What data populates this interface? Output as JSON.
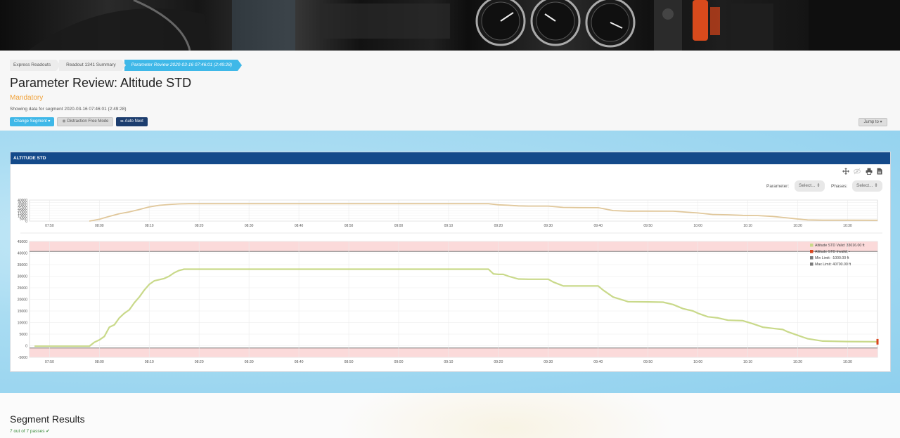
{
  "breadcrumb": {
    "items": [
      "Express Readouts",
      "Readout 1341 Summary",
      "Parameter Review 2020-03-16 07:46:01 (2:49:28)"
    ]
  },
  "page": {
    "title": "Parameter Review: Altitude STD",
    "subtitle": "Mandatory",
    "segment_info": "Showing data for segment 2020-03-16 07:46:01 (2:49:28)"
  },
  "toolbar": {
    "change_segment": "Change Segment",
    "distraction_free": "Distraction Free Mode",
    "auto_next": "Auto Next",
    "jump_to": "Jump to"
  },
  "panel": {
    "title": "ALTITUDE STD",
    "parameter_label": "Parameter:",
    "parameter_select": "Select...",
    "phases_label": "Phases:",
    "phases_select": "Select..."
  },
  "icons": {
    "move": "move-icon",
    "hide": "eye-slash-icon",
    "print": "print-icon",
    "export": "document-icon"
  },
  "chart_data": [
    {
      "type": "line",
      "title": "",
      "x_ticks": [
        "07:50",
        "08:00",
        "08:10",
        "08:20",
        "08:30",
        "08:40",
        "08:50",
        "09:00",
        "09:10",
        "09:20",
        "09:30",
        "09:40",
        "09:50",
        "10:00",
        "10:10",
        "10:20",
        "10:30"
      ],
      "y_ticks": [
        0,
        5000,
        10000,
        15000,
        20000,
        25000,
        30000,
        35000,
        40000
      ],
      "ylim": [
        0,
        40000
      ],
      "series": [
        {
          "color": "#e0c79a",
          "x": [
            "07:58",
            "08:00",
            "08:02",
            "08:04",
            "08:06",
            "08:08",
            "08:10",
            "08:12",
            "08:14",
            "08:16",
            "08:18",
            "08:20",
            "08:30",
            "08:40",
            "08:50",
            "09:00",
            "09:10",
            "09:18",
            "09:20",
            "09:22",
            "09:24",
            "09:26",
            "09:30",
            "09:33",
            "09:36",
            "09:40",
            "09:43",
            "09:46",
            "09:50",
            "09:55",
            "10:00",
            "10:03",
            "10:06",
            "10:09",
            "10:12",
            "10:15",
            "10:18",
            "10:20",
            "10:22",
            "10:25",
            "10:30",
            "10:36"
          ],
          "y": [
            0,
            3500,
            9000,
            14000,
            17500,
            22000,
            27000,
            30000,
            31500,
            32700,
            33016,
            33016,
            33016,
            33016,
            33016,
            33016,
            33016,
            33016,
            31000,
            30200,
            29000,
            28500,
            28500,
            26000,
            25600,
            25500,
            20000,
            19000,
            19000,
            18800,
            15500,
            12500,
            12000,
            11000,
            10500,
            9000,
            6000,
            4000,
            2200,
            1800,
            1700,
            1600
          ]
        }
      ]
    },
    {
      "type": "line",
      "title": "",
      "x_ticks": [
        "07:50",
        "08:00",
        "08:10",
        "08:20",
        "08:30",
        "08:40",
        "08:50",
        "09:00",
        "09:10",
        "09:20",
        "09:30",
        "09:40",
        "09:50",
        "10:00",
        "10:10",
        "10:20",
        "10:30"
      ],
      "y_ticks": [
        -5000,
        0,
        5000,
        10000,
        15000,
        20000,
        25000,
        30000,
        35000,
        40000,
        45000
      ],
      "ylim": [
        -5000,
        45000
      ],
      "legend_position": "top-right",
      "legend": [
        {
          "label": "Altitude STD Valid: 33016.00 ft",
          "color": "#c9d98a"
        },
        {
          "label": "Altitude STD Invalid: -",
          "color": "#d9441c"
        },
        {
          "label": "Min Limit: -1000.00 ft",
          "color": "#7a7a7a"
        },
        {
          "label": "Max Limit: 40700.00 ft",
          "color": "#7a7a7a"
        }
      ],
      "limits": {
        "min": -1000,
        "max": 40700,
        "band_color": "#fbdada"
      },
      "series": [
        {
          "name": "Altitude STD Valid",
          "color": "#c9d98a",
          "x": [
            "07:47",
            "07:58",
            "07:59",
            "08:00",
            "08:01",
            "08:02",
            "08:03",
            "08:04",
            "08:05",
            "08:06",
            "08:07",
            "08:08",
            "08:09",
            "08:10",
            "08:11",
            "08:12",
            "08:13",
            "08:14",
            "08:15",
            "08:16",
            "08:17",
            "08:18",
            "08:19",
            "08:20",
            "08:30",
            "08:40",
            "08:50",
            "09:00",
            "09:10",
            "09:18",
            "09:19",
            "09:20",
            "09:21",
            "09:22",
            "09:24",
            "09:26",
            "09:30",
            "09:31",
            "09:33",
            "09:36",
            "09:39",
            "09:40",
            "09:41",
            "09:43",
            "09:46",
            "09:50",
            "09:53",
            "09:55",
            "09:57",
            "09:59",
            "10:00",
            "10:02",
            "10:04",
            "10:06",
            "10:09",
            "10:11",
            "10:13",
            "10:15",
            "10:17",
            "10:18",
            "10:20",
            "10:22",
            "10:25",
            "10:30",
            "10:36"
          ],
          "y": [
            -200,
            -200,
            1500,
            2500,
            4000,
            8000,
            9000,
            12000,
            14000,
            15500,
            18500,
            21000,
            24000,
            26500,
            28000,
            28500,
            29000,
            30000,
            31500,
            32500,
            33016,
            33016,
            33016,
            33016,
            33016,
            33016,
            33016,
            33016,
            33016,
            33016,
            31000,
            30800,
            30800,
            30000,
            28800,
            28700,
            28700,
            27500,
            25800,
            25800,
            25800,
            25800,
            24000,
            21000,
            19000,
            18900,
            18800,
            17800,
            16000,
            15000,
            14000,
            12500,
            12000,
            11000,
            10800,
            9500,
            8000,
            7500,
            7000,
            6000,
            4500,
            3000,
            2000,
            1800,
            1700
          ]
        }
      ]
    }
  ],
  "results": {
    "title": "Segment Results",
    "summary": "7 out of 7 passes ✔"
  }
}
